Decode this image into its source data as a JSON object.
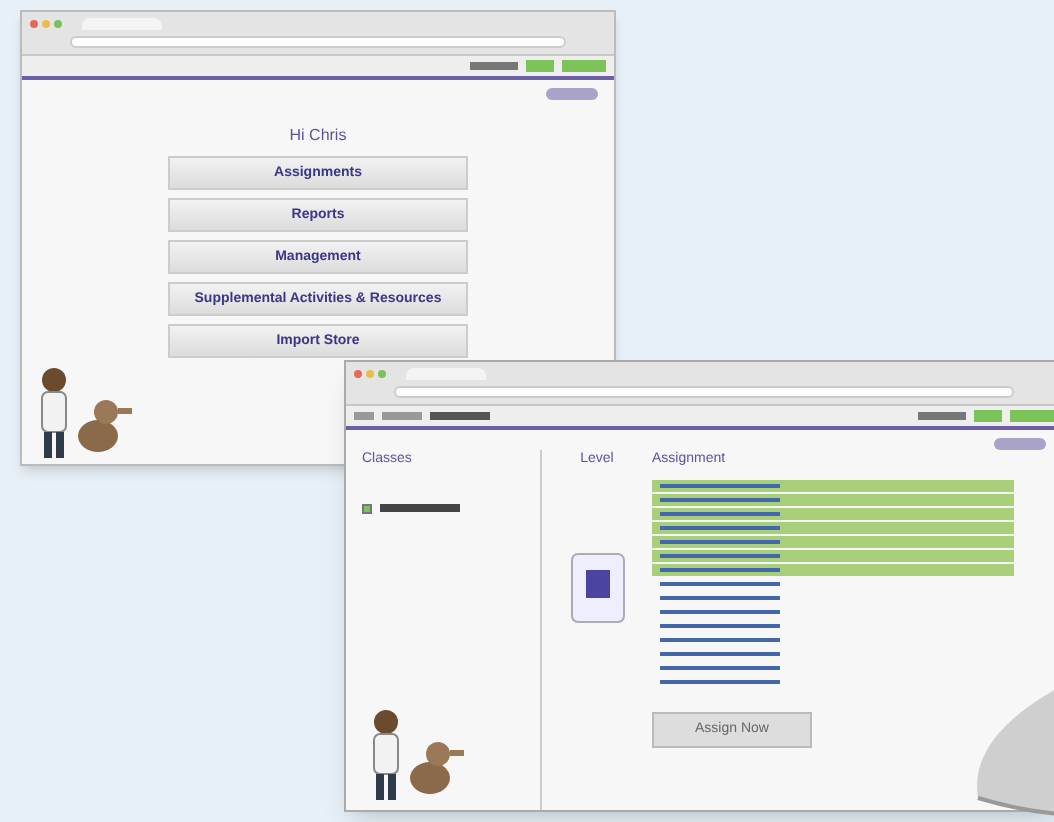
{
  "home_window": {
    "greeting": "Hi Chris",
    "menu_buttons": [
      "Assignments",
      "Reports",
      "Management",
      "Supplemental Activities & Resources",
      "Import Store"
    ]
  },
  "assign_window": {
    "nav_tabs": [
      {
        "selected": false
      },
      {
        "selected": false
      },
      {
        "selected": true
      }
    ],
    "columns": [
      "Classes",
      "Level",
      "Assignment"
    ],
    "class_item": {
      "checked": true
    },
    "assignments": [
      {
        "selected": true
      },
      {
        "selected": true
      },
      {
        "selected": true
      },
      {
        "selected": true
      },
      {
        "selected": true
      },
      {
        "selected": true
      },
      {
        "selected": true
      },
      {
        "selected": false
      },
      {
        "selected": false
      },
      {
        "selected": false
      },
      {
        "selected": false
      },
      {
        "selected": false
      },
      {
        "selected": false
      },
      {
        "selected": false
      },
      {
        "selected": false
      }
    ],
    "assign_button": "Assign Now"
  }
}
